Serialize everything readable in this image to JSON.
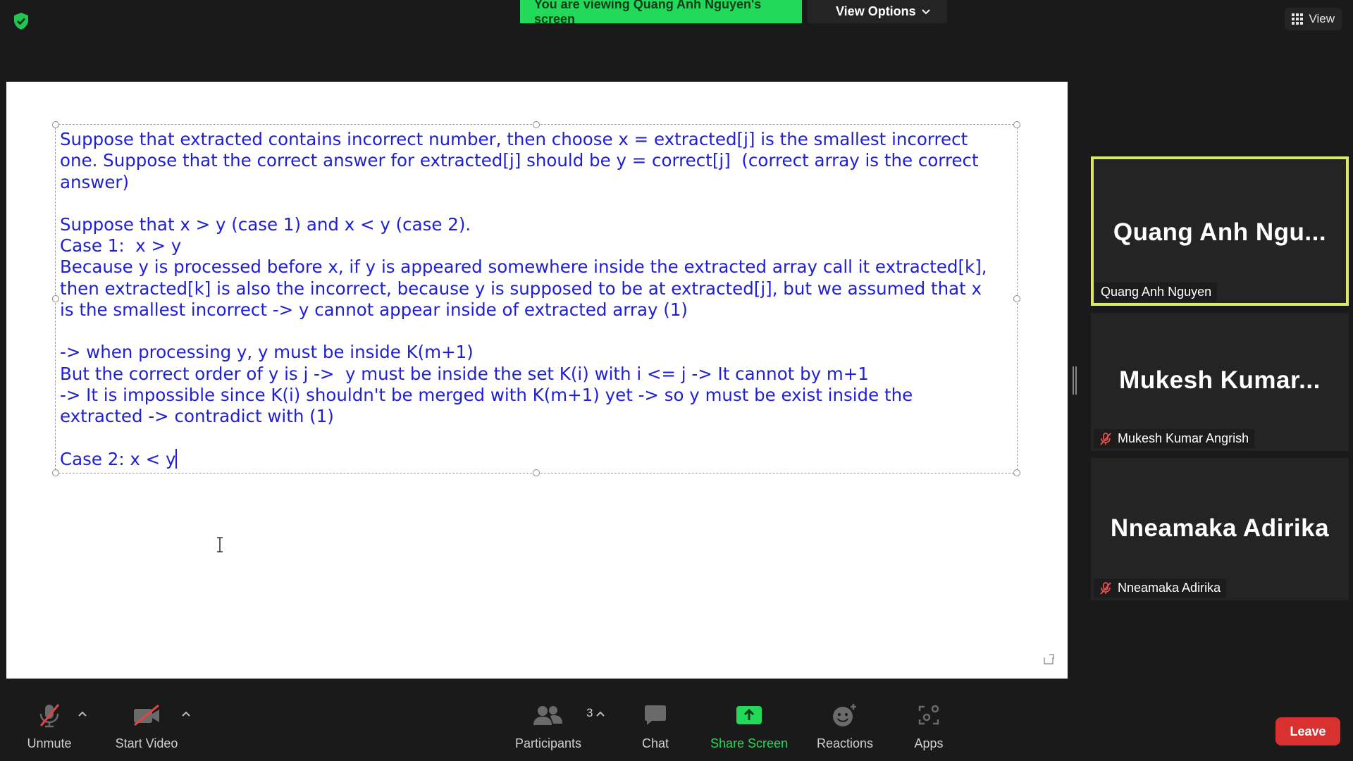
{
  "banner": {
    "viewing_text": "You are viewing Quang Anh Nguyen's screen",
    "view_options": "View Options"
  },
  "top_right": {
    "view_label": "View"
  },
  "document": {
    "lines": [
      "Suppose that extracted contains incorrect number, then choose x = extracted[j] is the smallest incorrect",
      "one. Suppose that the correct answer for extracted[j] should be y = correct[j]  (correct array is the correct",
      "answer)",
      "",
      "Suppose that x > y (case 1) and x < y (case 2).",
      "Case 1:  x > y",
      "Because y is processed before x, if y is appeared somewhere inside the extracted array call it extracted[k],",
      "then extracted[k] is also the incorrect, because y is supposed to be at extracted[j], but we assumed that x",
      "is the smallest incorrect -> y cannot appear inside of extracted array (1)",
      "",
      "-> when processing y, y must be inside K(m+1)",
      "But the correct order of y is j ->  y must be inside the set K(i) with i <= j -> It cannot by m+1",
      "-> It is impossible since K(i) shouldn't be merged with K(m+1) yet -> so y must be exist inside the",
      "extracted -> contradict with (1)",
      "",
      "Case 2: x < y"
    ],
    "text_color": "#1f1fd4"
  },
  "participants": [
    {
      "big_name": "Quang Anh Ngu...",
      "tag_name": "Quang Anh Nguyen",
      "muted": false,
      "active_speaker": true
    },
    {
      "big_name": "Mukesh Kumar...",
      "tag_name": "Mukesh Kumar Angrish",
      "muted": true,
      "active_speaker": false
    },
    {
      "big_name": "Nneamaka Adirika",
      "tag_name": "Nneamaka Adirika",
      "muted": true,
      "active_speaker": false
    }
  ],
  "toolbar": {
    "unmute": "Unmute",
    "start_video": "Start Video",
    "participants": "Participants",
    "participants_count": "3",
    "chat": "Chat",
    "share_screen": "Share Screen",
    "reactions": "Reactions",
    "apps": "Apps",
    "leave": "Leave"
  },
  "colors": {
    "banner_green": "#23d959",
    "active_border": "#dbe86a",
    "leave_red": "#d93030",
    "share_green": "#23d959"
  }
}
